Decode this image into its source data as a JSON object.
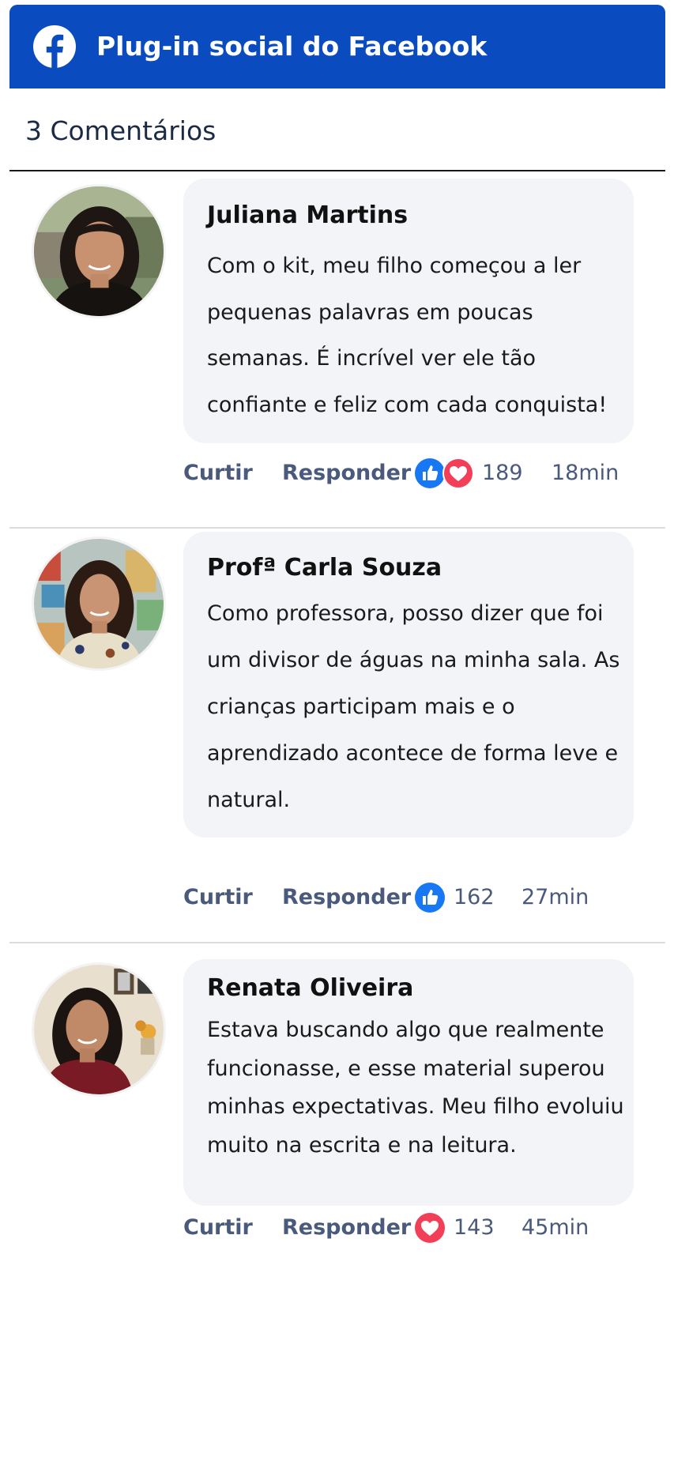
{
  "header": {
    "title": "Plug-in social do Facebook",
    "icon": "facebook-logo-icon",
    "color": "#0a4cbf"
  },
  "comments_count_label": "3 Comentários",
  "actions": {
    "like_label": "Curtir",
    "reply_label": "Responder"
  },
  "comments": [
    {
      "author": "Juliana Martins",
      "text": "Com o kit, meu filho começou a ler pequenas palavras em poucas semanas. É incrível ver ele tão confiante e feliz com cada conquista!",
      "reactions": [
        "like",
        "love"
      ],
      "reaction_count": "189",
      "time": "18min"
    },
    {
      "author": "Profª Carla Souza",
      "text": "Como professora, posso dizer que foi um divisor de águas na minha sala. As crianças participam mais e o aprendizado acontece de forma leve e natural.",
      "reactions": [
        "like"
      ],
      "reaction_count": "162",
      "time": "27min"
    },
    {
      "author": "Renata Oliveira",
      "text": "Estava buscando algo que realmente funcionasse, e esse material superou minhas expectativas. Meu filho evoluiu muito na escrita e na leitura.",
      "reactions": [
        "love"
      ],
      "reaction_count": "143",
      "time": "45min"
    }
  ],
  "colors": {
    "like": "#1877f2",
    "love": "#f33e58",
    "bubble": "#f3f4f8",
    "action_text": "#4a5a7c"
  }
}
